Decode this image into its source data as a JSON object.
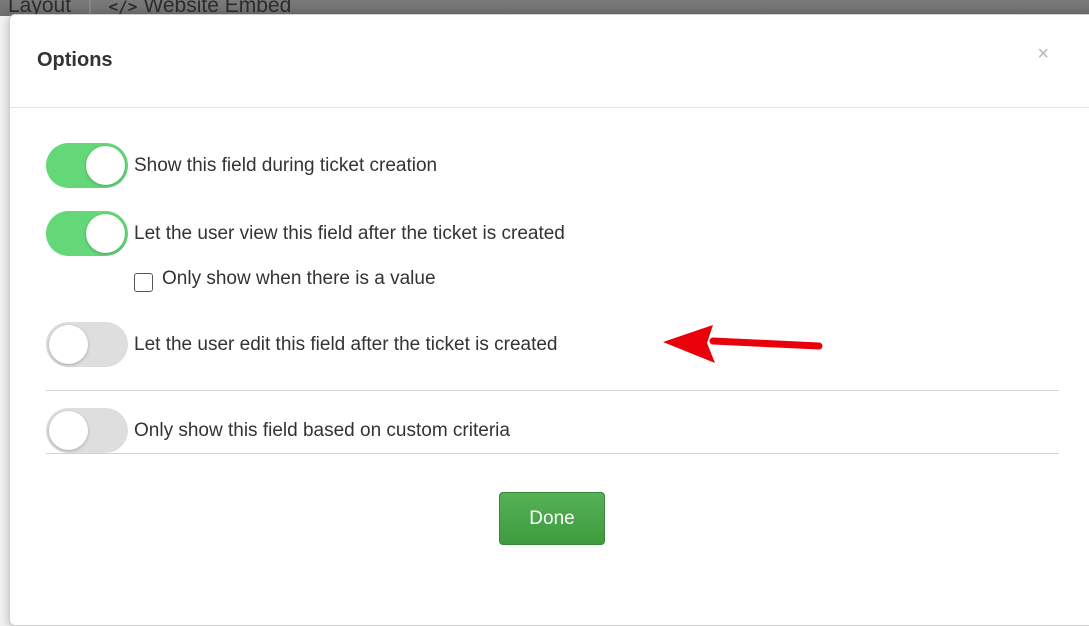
{
  "background": {
    "tabs": [
      "Layout",
      "Website Embed"
    ]
  },
  "modal": {
    "title": "Options",
    "close_symbol": "×",
    "options": [
      {
        "label": "Show this field during ticket creation",
        "enabled": true
      },
      {
        "label": "Let the user view this field after the ticket is created",
        "enabled": true
      },
      {
        "label": "Let the user edit this field after the ticket is created",
        "enabled": false
      },
      {
        "label": "Only show this field based on custom criteria",
        "enabled": false
      }
    ],
    "sub_option": {
      "label": "Only show when there is a value",
      "checked": false
    },
    "done_label": "Done"
  },
  "annotation": {
    "icon": "red-arrow-icon",
    "color": "#e8000b"
  },
  "colors": {
    "toggle_on": "#64d878",
    "toggle_off": "#dedede",
    "done_button": "#47a447"
  }
}
